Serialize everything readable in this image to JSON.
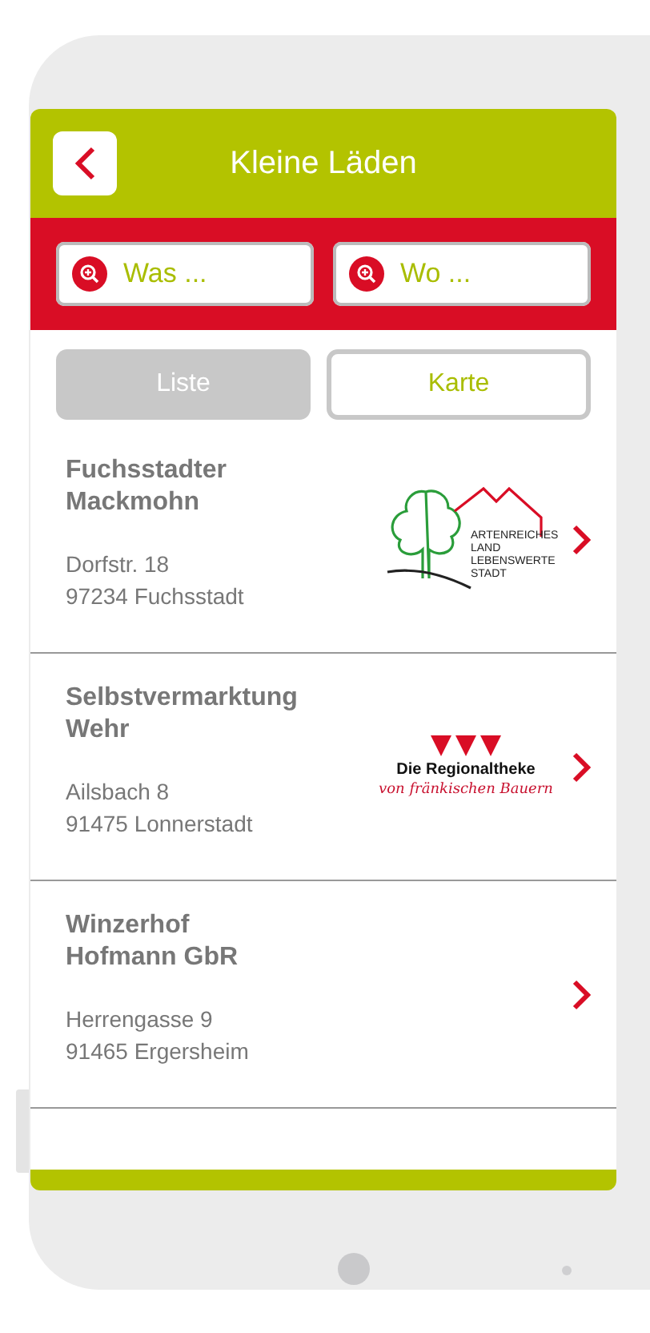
{
  "header": {
    "title": "Kleine Läden"
  },
  "search": [
    {
      "placeholder": "Was ..."
    },
    {
      "placeholder": "Wo ..."
    }
  ],
  "view_toggle": [
    {
      "label": "Liste",
      "selected": true
    },
    {
      "label": "Karte",
      "selected": false
    }
  ],
  "shops": [
    {
      "name": "Fuchsstadter Mackmohn",
      "street": "Dorfstr. 18",
      "city": "97234 Fuchsstadt",
      "logo": {
        "kind": "tree",
        "lines": [
          "ARTENREICHES",
          "LAND",
          "LEBENSWERTE",
          "STADT"
        ]
      }
    },
    {
      "name": "Selbstvermarktung Wehr",
      "street": "Ailsbach 8",
      "city": "91475 Lonnerstadt",
      "logo": {
        "kind": "triangles",
        "lines": [
          "Die Regionaltheke",
          "von fränkischen Bauern"
        ]
      }
    },
    {
      "name": "Winzerhof Hofmann GbR",
      "street": "Herrengasse 9",
      "city": "91465 Ergersheim"
    }
  ]
}
